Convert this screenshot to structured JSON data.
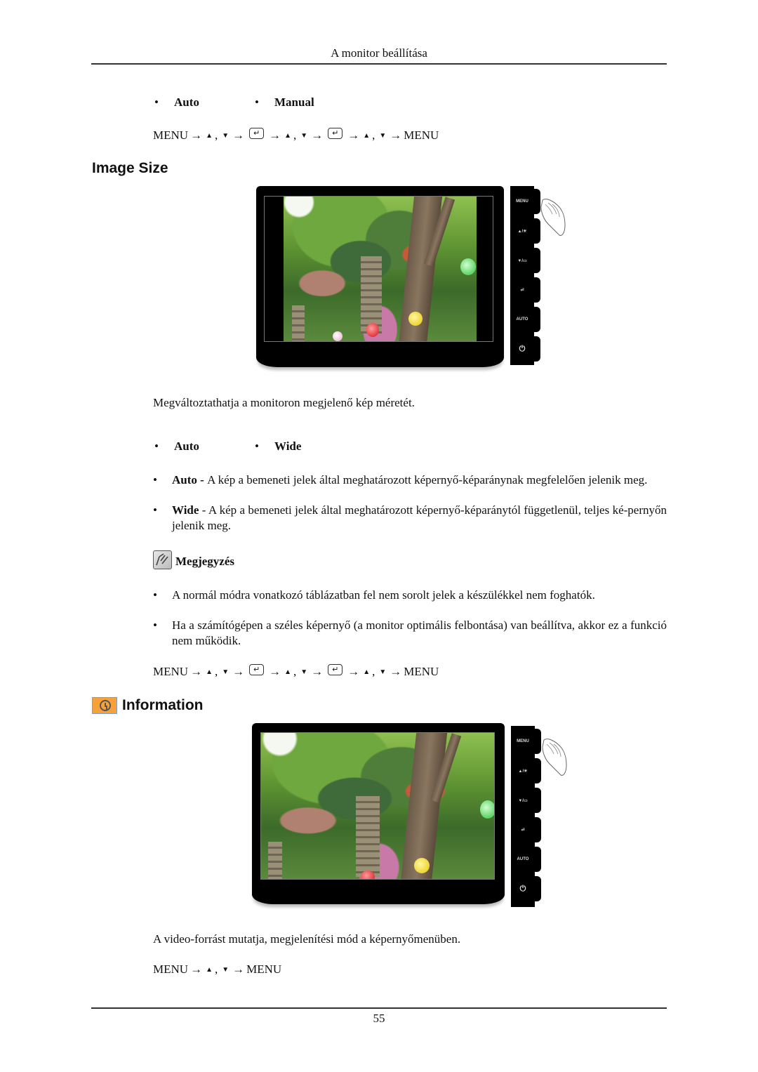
{
  "header": {
    "title": "A monitor beállítása"
  },
  "section_color_mode": {
    "options": [
      "Auto",
      "Manual"
    ],
    "sequence": [
      "MENU",
      "→",
      "▲",
      ",",
      "▼",
      "→",
      "enter",
      "→",
      "▲",
      ",",
      "▼",
      "→",
      "enter",
      "→",
      "▲",
      ",",
      "▼",
      "→",
      "MENU"
    ]
  },
  "image_size": {
    "heading": "Image Size",
    "description": "Megváltoztathatja a monitoron megjelenő kép méretét.",
    "options": [
      "Auto",
      "Wide"
    ],
    "details": [
      {
        "label": "Auto",
        "sep": " - ",
        "text": "A kép a bemeneti jelek által meghatározott képernyő-képaránynak megfelelően jelenik meg."
      },
      {
        "label": "Wide",
        "sep": " - ",
        "text": "A kép a bemeneti jelek által meghatározott képernyő-képaránytól függetlenül, teljes ké-pernyőn jelenik meg."
      }
    ],
    "note": {
      "label": "Megjegyzés",
      "items": [
        "A normál módra vonatkozó táblázatban fel nem sorolt jelek a készülékkel nem foghatók.",
        "Ha a számítógépen a széles képernyő (a monitor optimális felbontása) van beállítva, akkor ez a funkció nem működik."
      ]
    },
    "sequence": [
      "MENU",
      "→",
      "▲",
      ",",
      "▼",
      "→",
      "enter",
      "→",
      "▲",
      ",",
      "▼",
      "→",
      "enter",
      "→",
      "▲",
      ",",
      "▼",
      "→",
      "MENU"
    ]
  },
  "information": {
    "heading": "Information",
    "description": "A video-forrást mutatja, megjelenítési mód a képernyőmenüben.",
    "sequence": [
      "MENU",
      "→",
      "▲",
      ",",
      "▼",
      "→",
      "MENU"
    ]
  },
  "monitor_buttons": [
    "MENU",
    "▲/☀",
    "▼/▭",
    "⏎",
    "AUTO",
    "⏻"
  ],
  "footer": {
    "page_number": "55"
  }
}
